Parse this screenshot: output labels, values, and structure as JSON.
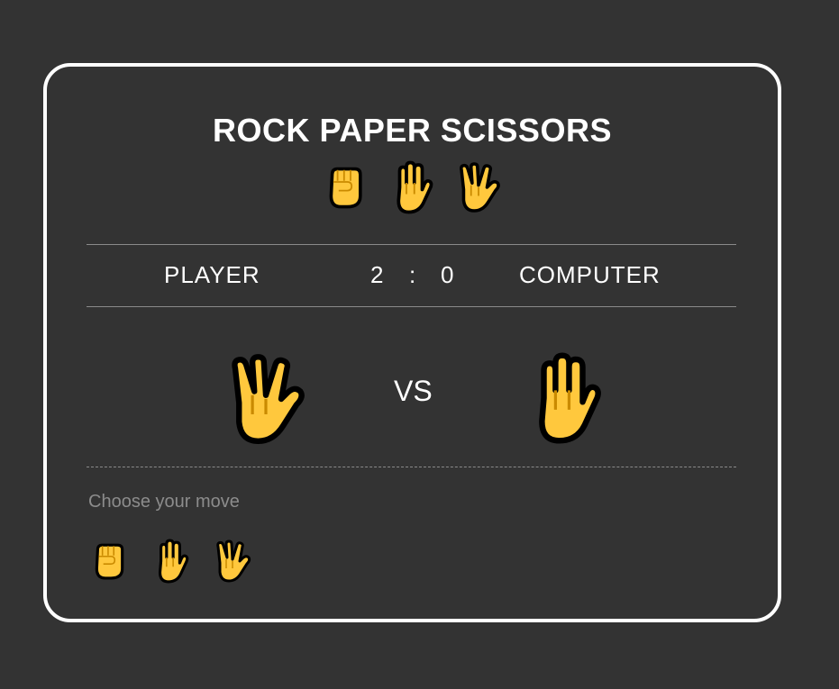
{
  "game": {
    "title": "ROCK PAPER SCISSORS",
    "title_icons": [
      "raised-fist-icon",
      "raised-hand-icon",
      "vulcan-salute-icon"
    ]
  },
  "scoreboard": {
    "player_label": "PLAYER",
    "computer_label": "COMPUTER",
    "player_score": "2",
    "separator": ":",
    "computer_score": "0"
  },
  "round": {
    "player_move_icon": "vulcan-salute-icon",
    "vs_label": "VS",
    "computer_move_icon": "raised-hand-icon"
  },
  "moves": {
    "prompt": "Choose your move",
    "options": [
      "raised-fist-icon",
      "raised-hand-icon",
      "vulcan-salute-icon"
    ]
  },
  "colors": {
    "background": "#333333",
    "card_border": "#ffffff",
    "text": "#ffffff",
    "muted_text": "#8c8c8c",
    "hand_fill": "#ffc83d",
    "hand_outline": "#000000"
  }
}
